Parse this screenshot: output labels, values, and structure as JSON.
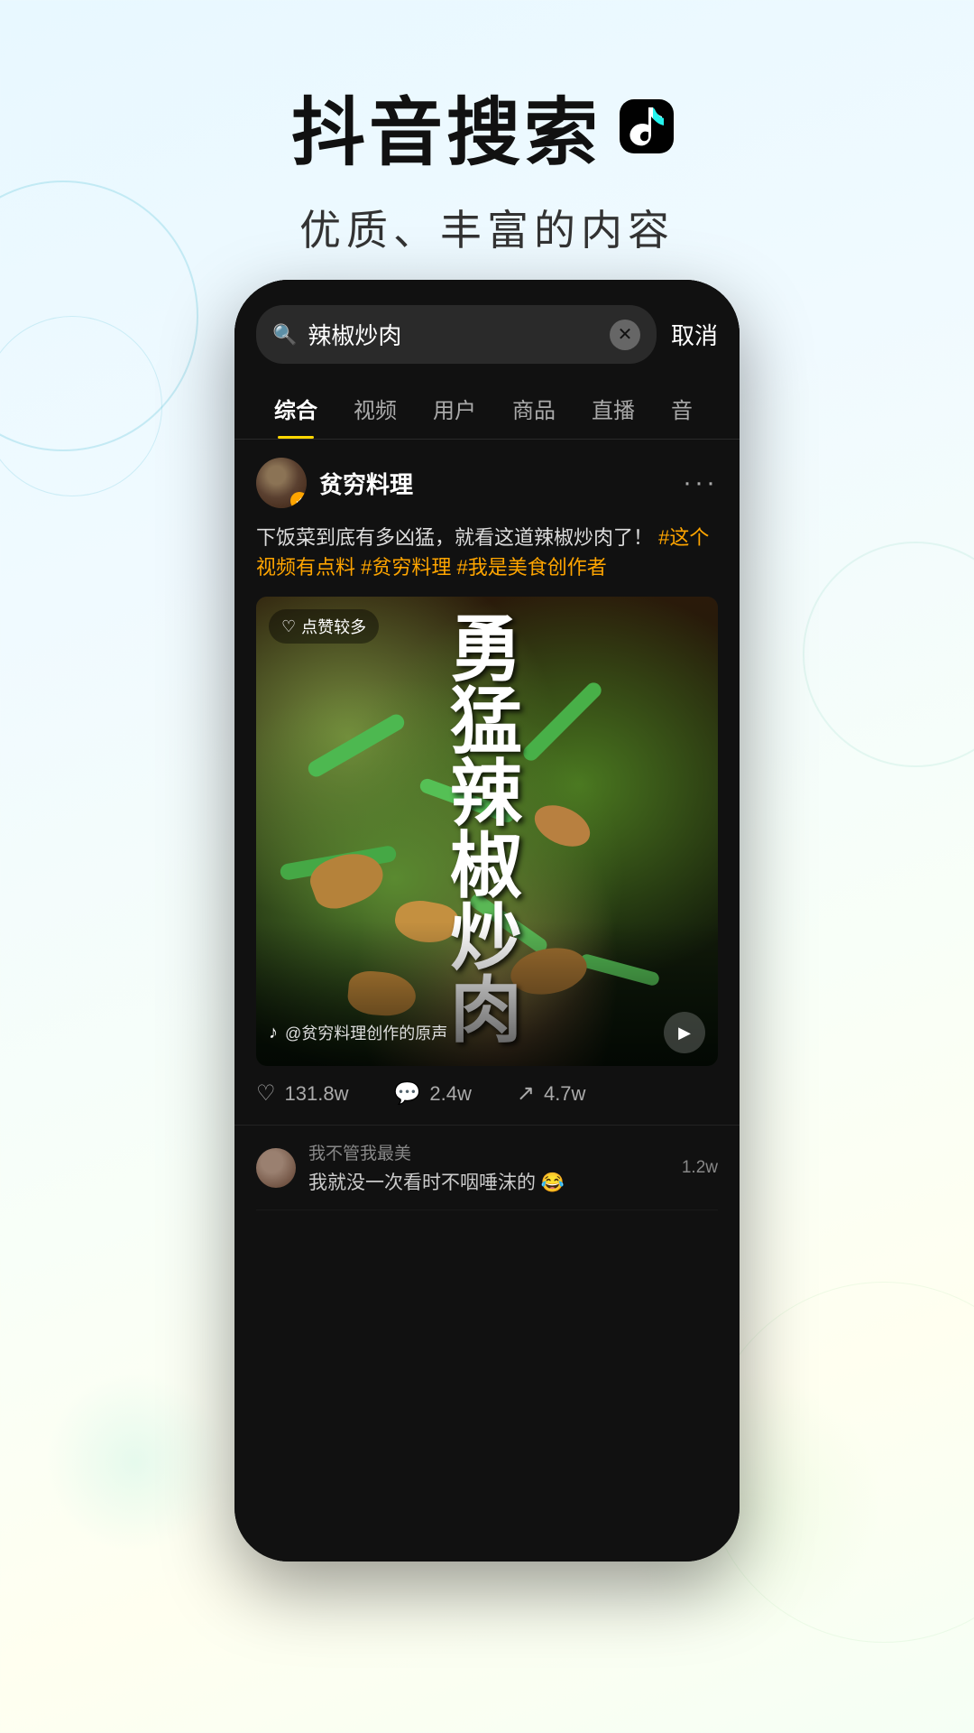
{
  "header": {
    "main_title": "抖音搜索",
    "subtitle": "优质、丰富的内容"
  },
  "phone": {
    "search": {
      "query": "辣椒炒肉",
      "cancel_label": "取消"
    },
    "tabs": [
      {
        "label": "综合",
        "active": true
      },
      {
        "label": "视频",
        "active": false
      },
      {
        "label": "用户",
        "active": false
      },
      {
        "label": "商品",
        "active": false
      },
      {
        "label": "直播",
        "active": false
      },
      {
        "label": "音",
        "active": false
      }
    ],
    "post": {
      "author": "贫穷料理",
      "text": "下饭菜到底有多凶猛，就看这道辣椒炒肉了！",
      "hashtags": "#这个视频有点料 #贫穷料理 #我是美食创作者",
      "likes_badge": "点赞较多",
      "video_title": "勇猛的辣椒炒肉",
      "audio_info": "@贫穷料理创作的原声",
      "stats": {
        "likes": "131.8w",
        "comments": "2.4w",
        "shares": "4.7w"
      }
    },
    "comment_preview": {
      "user": "我不管我最美",
      "text": "我就没一次看时不咽唾沫的 😂",
      "count": "1.2w"
    }
  }
}
